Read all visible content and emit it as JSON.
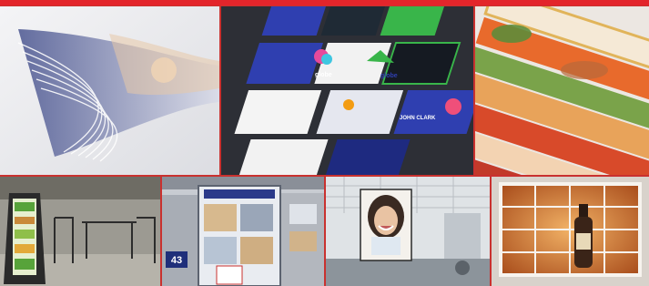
{
  "colors": {
    "accent_bar": "#e3252b",
    "divider": "#c9312f",
    "business_card_blue": "#2f3fb0",
    "business_card_green": "#39b54a",
    "backlit_window_amber": "#c76a24"
  },
  "tiles": {
    "business_cards": {
      "card_brand_1": "globe",
      "card_brand_2": "globe",
      "card_name": "JOHN CLARK"
    },
    "store_display": {
      "aisle_number": "43"
    }
  }
}
